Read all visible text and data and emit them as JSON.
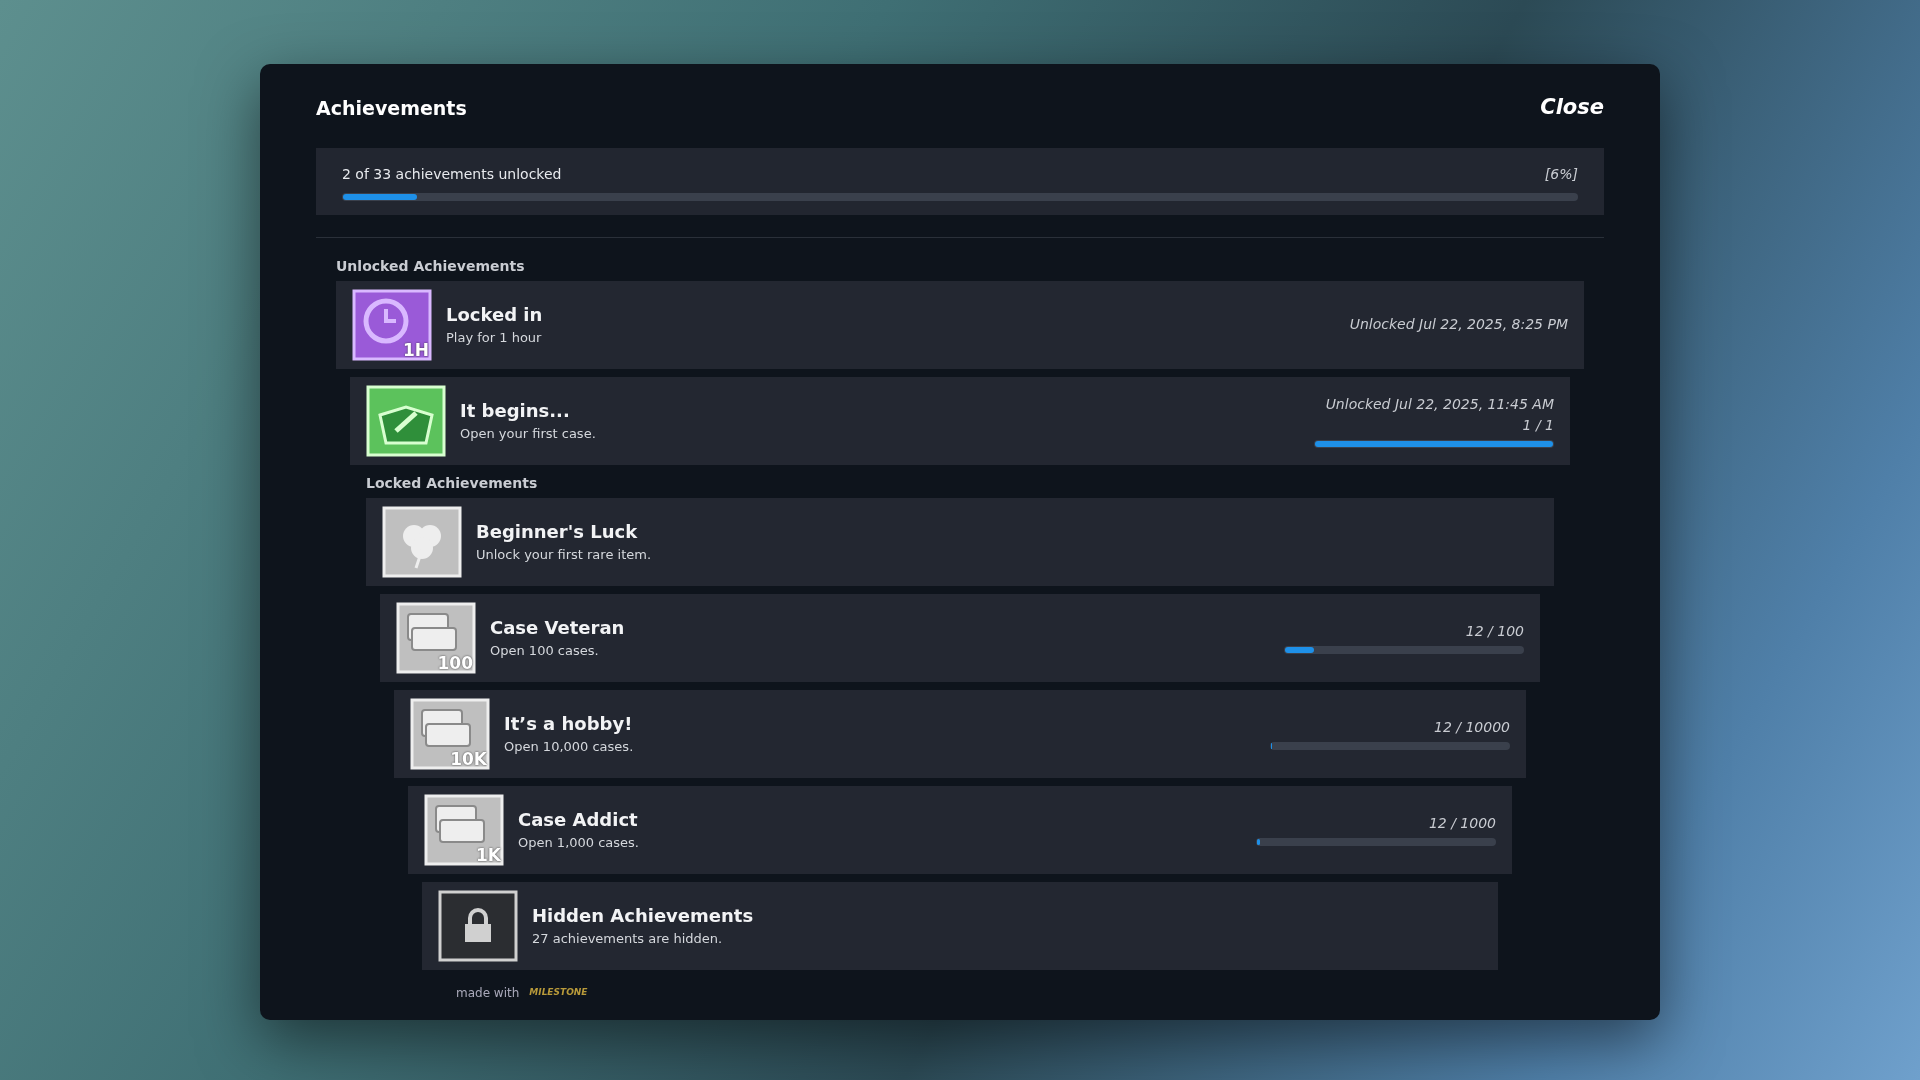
{
  "dialog": {
    "title": "Achievements",
    "close": "Close"
  },
  "summary": {
    "text": "2 of 33 achievements unlocked",
    "percent": "[6%]",
    "level": 0.06
  },
  "sections": [
    {
      "heading": "Unlocked Achievements",
      "items": [
        {
          "kind": "clock",
          "badge": "1H",
          "title": "Locked in",
          "description": "Play for 1 hour",
          "unlocked": "Unlocked Jul 22, 2025, 8:25 PM"
        },
        {
          "kind": "case",
          "title": "It begins...",
          "description": "Open your first case.",
          "unlocked": "Unlocked Jul 22, 2025, 11:45 AM",
          "progress": "1 / 1",
          "level": 1
        }
      ]
    },
    {
      "heading": "Locked Achievements",
      "items": [
        {
          "kind": "clover",
          "title": "Beginner's Luck",
          "description": "Unlock your first rare item."
        },
        {
          "kind": "cases",
          "badge": "100",
          "title": "Case Veteran",
          "description": "Open 100 cases.",
          "progress": "12 / 100",
          "level": 0.12
        },
        {
          "kind": "cases",
          "badge": "10K",
          "title": "It’s a hobby!",
          "description": "Open 10,000 cases.",
          "progress": "12 / 10000",
          "level": 0.0012
        },
        {
          "kind": "cases",
          "badge": "1K",
          "title": "Case Addict",
          "description": "Open 1,000 cases.",
          "progress": "12 / 1000",
          "level": 0.012
        },
        {
          "kind": "lock",
          "title": "Hidden Achievements",
          "description": "27 achievements are hidden."
        }
      ]
    }
  ],
  "footer": {
    "text": "made with",
    "logo": "MILESTONE"
  }
}
